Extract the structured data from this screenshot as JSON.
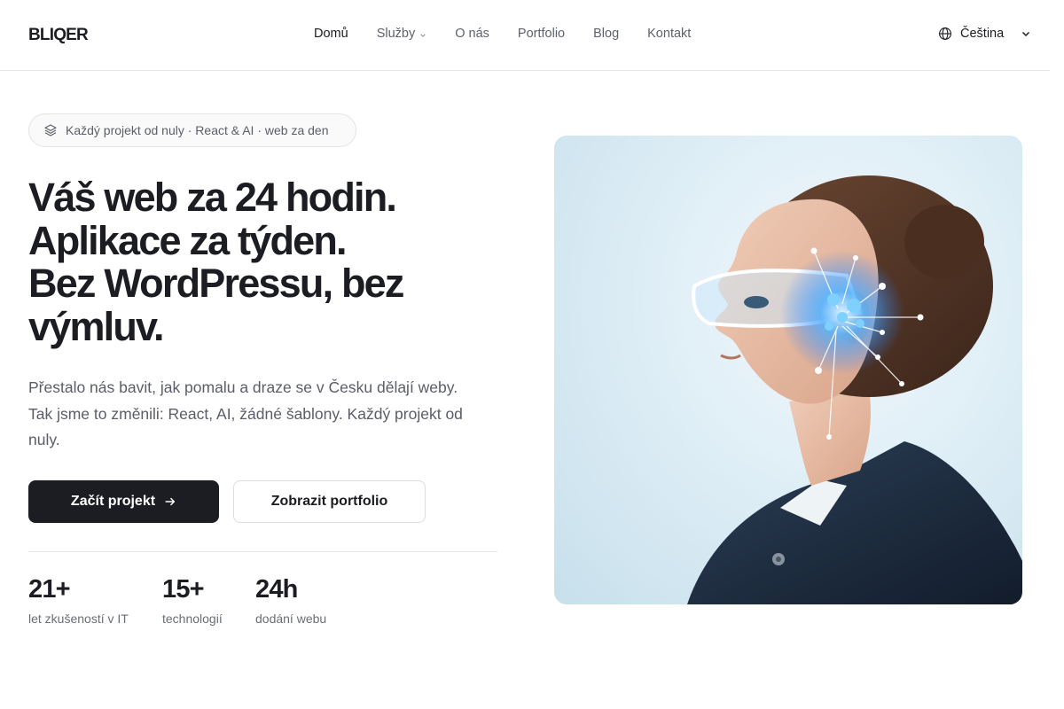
{
  "brand": {
    "logo": "BLIQER"
  },
  "nav": {
    "items": [
      {
        "label": "Domů",
        "active": true,
        "has_dropdown": false
      },
      {
        "label": "Služby",
        "active": false,
        "has_dropdown": true
      },
      {
        "label": "O nás",
        "active": false,
        "has_dropdown": false
      },
      {
        "label": "Portfolio",
        "active": false,
        "has_dropdown": false
      },
      {
        "label": "Blog",
        "active": false,
        "has_dropdown": false
      },
      {
        "label": "Kontakt",
        "active": false,
        "has_dropdown": false
      }
    ],
    "language": {
      "label": "Čeština",
      "icon": "globe-icon"
    }
  },
  "hero": {
    "badge": {
      "icon": "layers-icon",
      "text": "Každý projekt od nuly · React & AI · web za den"
    },
    "headline": {
      "line1": "Váš web za 24 hodin.",
      "line2": "Aplikace za týden.",
      "line3": "Bez WordPressu, bez",
      "line4": "výmluv."
    },
    "lead": "Přestalo nás bavit, jak pomalu a draze se v Česku dělají weby. Tak jsme to změnili: React, AI, žádné šablony. Každý projekt od nuly.",
    "cta_primary": {
      "label": "Začít projekt",
      "icon": "arrow-right-icon"
    },
    "cta_secondary": {
      "label": "Zobrazit portfolio"
    },
    "image": {
      "subject": "woman-with-ai-visor-illustration"
    }
  },
  "stats": [
    {
      "value": "21+",
      "label": "let zkušeností v IT"
    },
    {
      "value": "15+",
      "label": "technologií"
    },
    {
      "value": "24h",
      "label": "dodání webu"
    }
  ],
  "colors": {
    "text_primary": "#1c1d22",
    "text_muted": "#5b5e68",
    "button_dark": "#1c1d22",
    "border": "#e6e7ea",
    "visor_glow": "#3a9dff"
  }
}
